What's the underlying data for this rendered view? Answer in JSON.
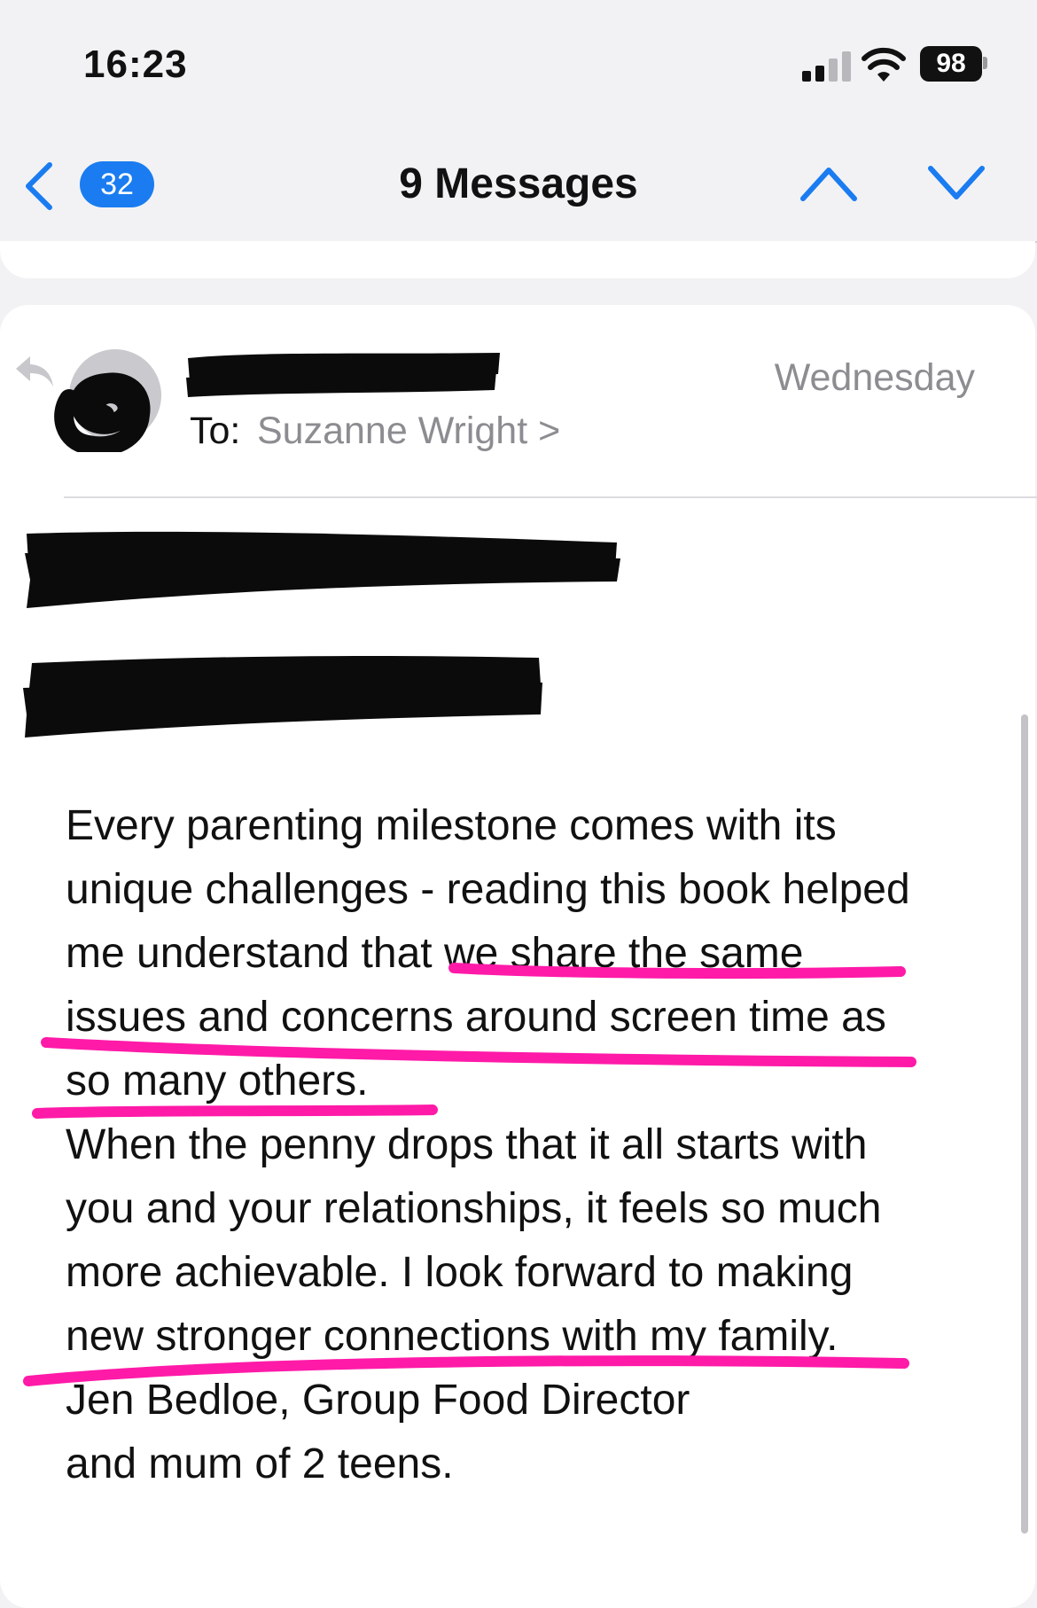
{
  "status_bar": {
    "time": "16:23",
    "battery": "98",
    "icons": [
      "cellular-signal-icon",
      "wifi-icon",
      "battery-icon"
    ]
  },
  "nav": {
    "back_badge": "32",
    "title": "9 Messages",
    "icons": [
      "back-chevron-icon",
      "chevron-up-icon",
      "chevron-down-icon"
    ]
  },
  "message": {
    "to_label": "To:",
    "to_name": "Suzanne Wright >",
    "date": "Wednesday",
    "body_lines": [
      "Every parenting milestone comes with its",
      "unique challenges - reading this book helped",
      "me understand that we share the same",
      "issues and concerns around screen time as",
      "so many others.",
      "When the penny drops that it all starts with",
      "you and your relationships, it feels so much",
      "more achievable. I look forward to making",
      "new stronger connections with my family.",
      "Jen Bedloe, Group Food Director",
      "and mum of 2 teens."
    ]
  },
  "colors": {
    "accent_blue": "#1a7cf0",
    "highlight_pink": "#ff1aa8",
    "redaction_black": "#0b0b0b",
    "secondary_gray": "#8c8c91"
  }
}
